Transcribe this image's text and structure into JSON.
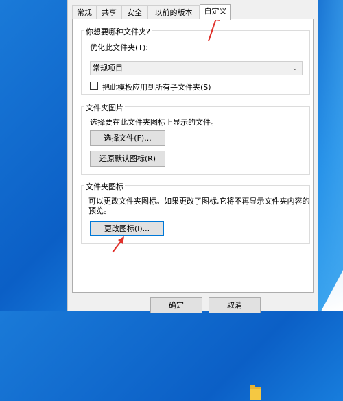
{
  "tabs": [
    {
      "label": "常规"
    },
    {
      "label": "共享"
    },
    {
      "label": "安全"
    },
    {
      "label": "以前的版本"
    },
    {
      "label": "自定义",
      "active": true
    }
  ],
  "optimize": {
    "group_title": "你想要哪种文件夹?",
    "label": "优化此文件夹(T):",
    "selected": "常规项目",
    "checkbox_label": "把此模板应用到所有子文件夹(S)",
    "checked": false
  },
  "folder_pictures": {
    "group_title": "文件夹图片",
    "description": "选择要在此文件夹图标上显示的文件。",
    "choose_file_button": "选择文件(F)...",
    "restore_default_button": "还原默认图标(R)"
  },
  "folder_icons": {
    "group_title": "文件夹图标",
    "description_line1": "可以更改文件夹图标。如果更改了图标,它将不再显示文件夹内容的",
    "description_line2": "预览。",
    "change_icon_button": "更改图标(I)..."
  },
  "footer": {
    "ok_button": "确定",
    "cancel_button": "取消"
  },
  "colors": {
    "accent": "#0078d7",
    "arrow": "#e0302a",
    "folder": "#f5c842"
  }
}
